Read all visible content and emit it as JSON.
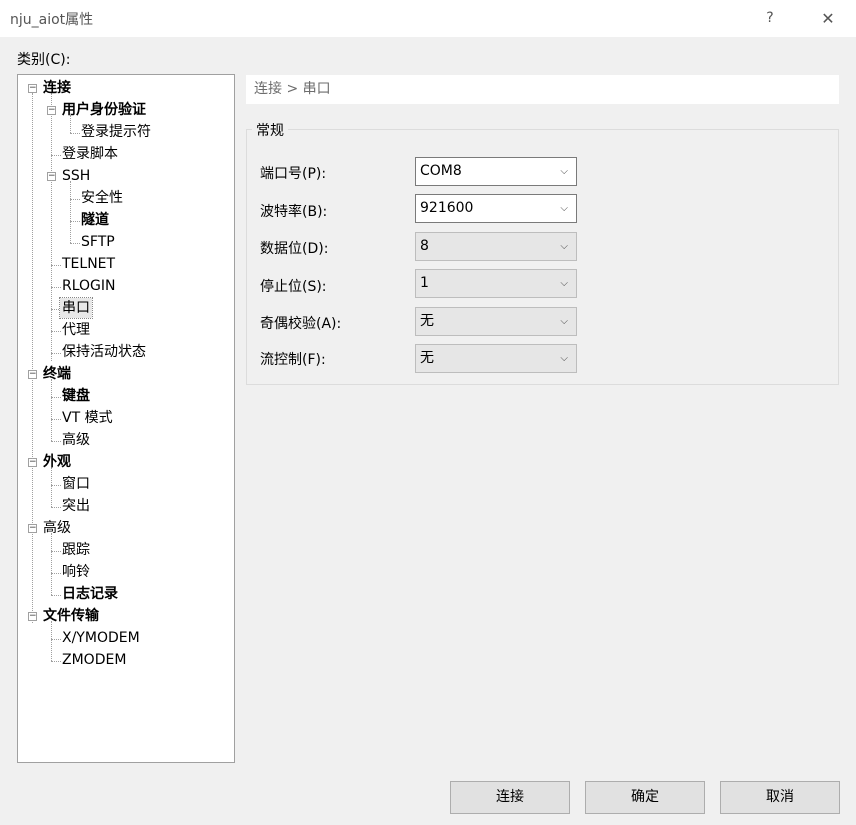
{
  "window": {
    "title": "nju_aiot属性",
    "help": "?",
    "close": "✕"
  },
  "category_label": "类别(C):",
  "tree": [
    {
      "label": "连接",
      "bold": true
    },
    {
      "label": "用户身份验证",
      "bold": true
    },
    {
      "label": "登录提示符",
      "bold": false
    },
    {
      "label": "登录脚本",
      "bold": false
    },
    {
      "label": "SSH",
      "bold": false
    },
    {
      "label": "安全性",
      "bold": false
    },
    {
      "label": "隧道",
      "bold": true
    },
    {
      "label": "SFTP",
      "bold": false
    },
    {
      "label": "TELNET",
      "bold": false
    },
    {
      "label": "RLOGIN",
      "bold": false
    },
    {
      "label": "串口",
      "bold": false
    },
    {
      "label": "代理",
      "bold": false
    },
    {
      "label": "保持活动状态",
      "bold": false
    },
    {
      "label": "终端",
      "bold": true
    },
    {
      "label": "键盘",
      "bold": true
    },
    {
      "label": "VT 模式",
      "bold": false
    },
    {
      "label": "高级",
      "bold": false
    },
    {
      "label": "外观",
      "bold": true
    },
    {
      "label": "窗口",
      "bold": false
    },
    {
      "label": "突出",
      "bold": false
    },
    {
      "label": "高级",
      "bold": false
    },
    {
      "label": "跟踪",
      "bold": false
    },
    {
      "label": "响铃",
      "bold": false
    },
    {
      "label": "日志记录",
      "bold": true
    },
    {
      "label": "文件传输",
      "bold": true
    },
    {
      "label": "X/YMODEM",
      "bold": false
    },
    {
      "label": "ZMODEM",
      "bold": false
    }
  ],
  "tree_selected": "串口",
  "breadcrumb": "连接 > 串口",
  "group_title": "常规",
  "fields": [
    {
      "label": "端口号(P):",
      "value": "COM8",
      "enabled": true
    },
    {
      "label": "波特率(B):",
      "value": "921600",
      "enabled": true
    },
    {
      "label": "数据位(D):",
      "value": "8",
      "enabled": false
    },
    {
      "label": "停止位(S):",
      "value": "1",
      "enabled": false
    },
    {
      "label": "奇偶校验(A):",
      "value": "无",
      "enabled": false
    },
    {
      "label": "流控制(F):",
      "value": "无",
      "enabled": false
    }
  ],
  "buttons": {
    "connect": "连接",
    "ok": "确定",
    "cancel": "取消"
  },
  "icons": {
    "expander": "minus-box-icon",
    "dropdown": "chevron-down-icon"
  }
}
